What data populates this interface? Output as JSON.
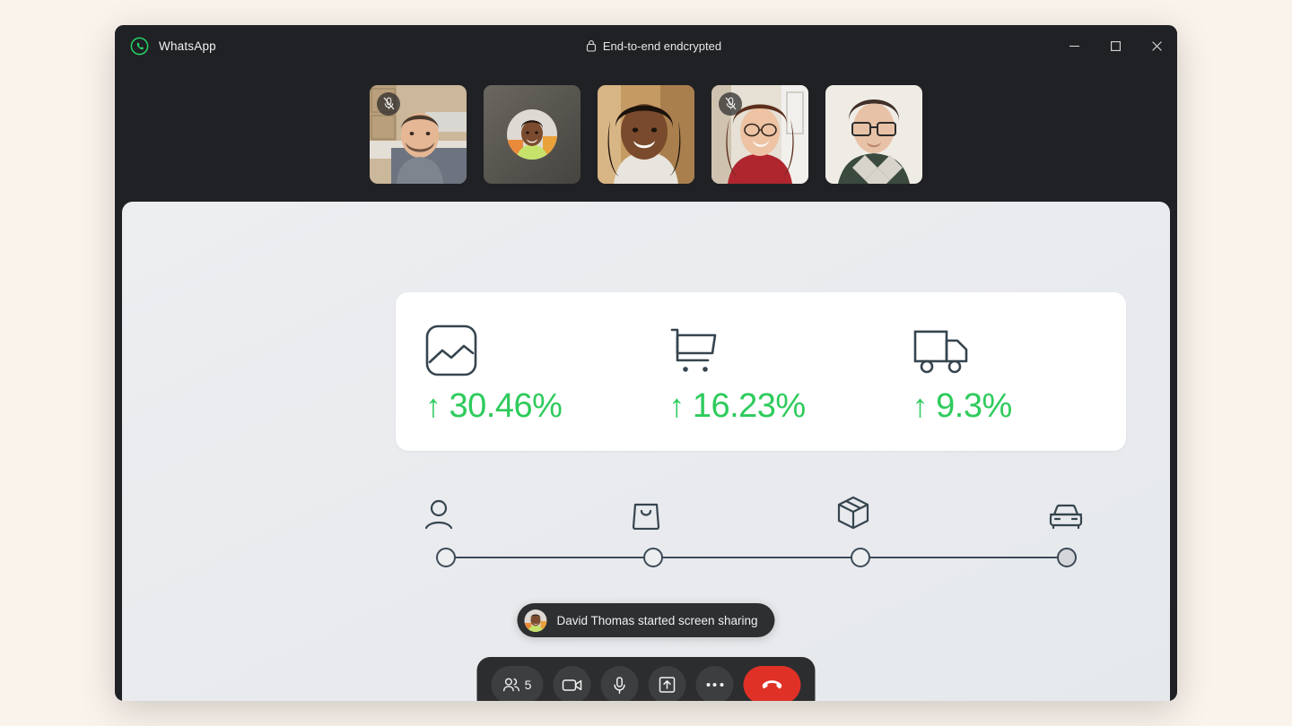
{
  "window": {
    "app_name": "WhatsApp",
    "encryption_label": "End-to-end endcrypted",
    "logo_icon": "whatsapp-logo-icon",
    "lock_icon": "lock-icon",
    "controls": [
      {
        "name": "minimize",
        "icon": "minimize-icon"
      },
      {
        "name": "maximize",
        "icon": "maximize-icon"
      },
      {
        "name": "close",
        "icon": "close-icon"
      }
    ]
  },
  "participants": [
    {
      "id": "p1",
      "muted": true,
      "video_on": true,
      "mute_icon": "microphone-off-icon"
    },
    {
      "id": "p2",
      "muted": false,
      "video_on": false,
      "avatar": "participant-avatar"
    },
    {
      "id": "p3",
      "muted": false,
      "video_on": true
    },
    {
      "id": "p4",
      "muted": true,
      "video_on": true,
      "mute_icon": "microphone-off-icon"
    },
    {
      "id": "p5",
      "muted": false,
      "video_on": true
    }
  ],
  "shared_screen": {
    "stats": [
      {
        "icon": "chart-image-icon",
        "direction": "up",
        "arrow": "↑",
        "value": "30.46%"
      },
      {
        "icon": "shopping-cart-icon",
        "direction": "up",
        "arrow": "↑",
        "value": "16.23%"
      },
      {
        "icon": "delivery-truck-icon",
        "direction": "up",
        "arrow": "↑",
        "value": "9.3%"
      }
    ],
    "stat_value_color": "#2ecb5c",
    "stepper": {
      "steps": [
        {
          "icon": "person-icon",
          "state": "empty"
        },
        {
          "icon": "shopping-bag-icon",
          "state": "empty"
        },
        {
          "icon": "package-box-icon",
          "state": "empty"
        },
        {
          "icon": "car-icon",
          "state": "filled"
        }
      ],
      "line_color": "#3c4a57"
    }
  },
  "toast": {
    "avatar_icon": "sharer-avatar",
    "message": "David Thomas started screen sharing"
  },
  "call_controls": {
    "participants_count": "5",
    "buttons": [
      {
        "name": "participants-button",
        "icon": "people-icon",
        "label": "5"
      },
      {
        "name": "camera-button",
        "icon": "video-camera-icon",
        "label": ""
      },
      {
        "name": "microphone-button",
        "icon": "microphone-icon",
        "label": ""
      },
      {
        "name": "share-screen-button",
        "icon": "share-screen-icon",
        "label": ""
      },
      {
        "name": "more-options-button",
        "icon": "more-horizontal-icon",
        "label": ""
      },
      {
        "name": "end-call-button",
        "icon": "phone-hangup-icon",
        "label": ""
      }
    ],
    "end_call_color": "#e03127"
  }
}
